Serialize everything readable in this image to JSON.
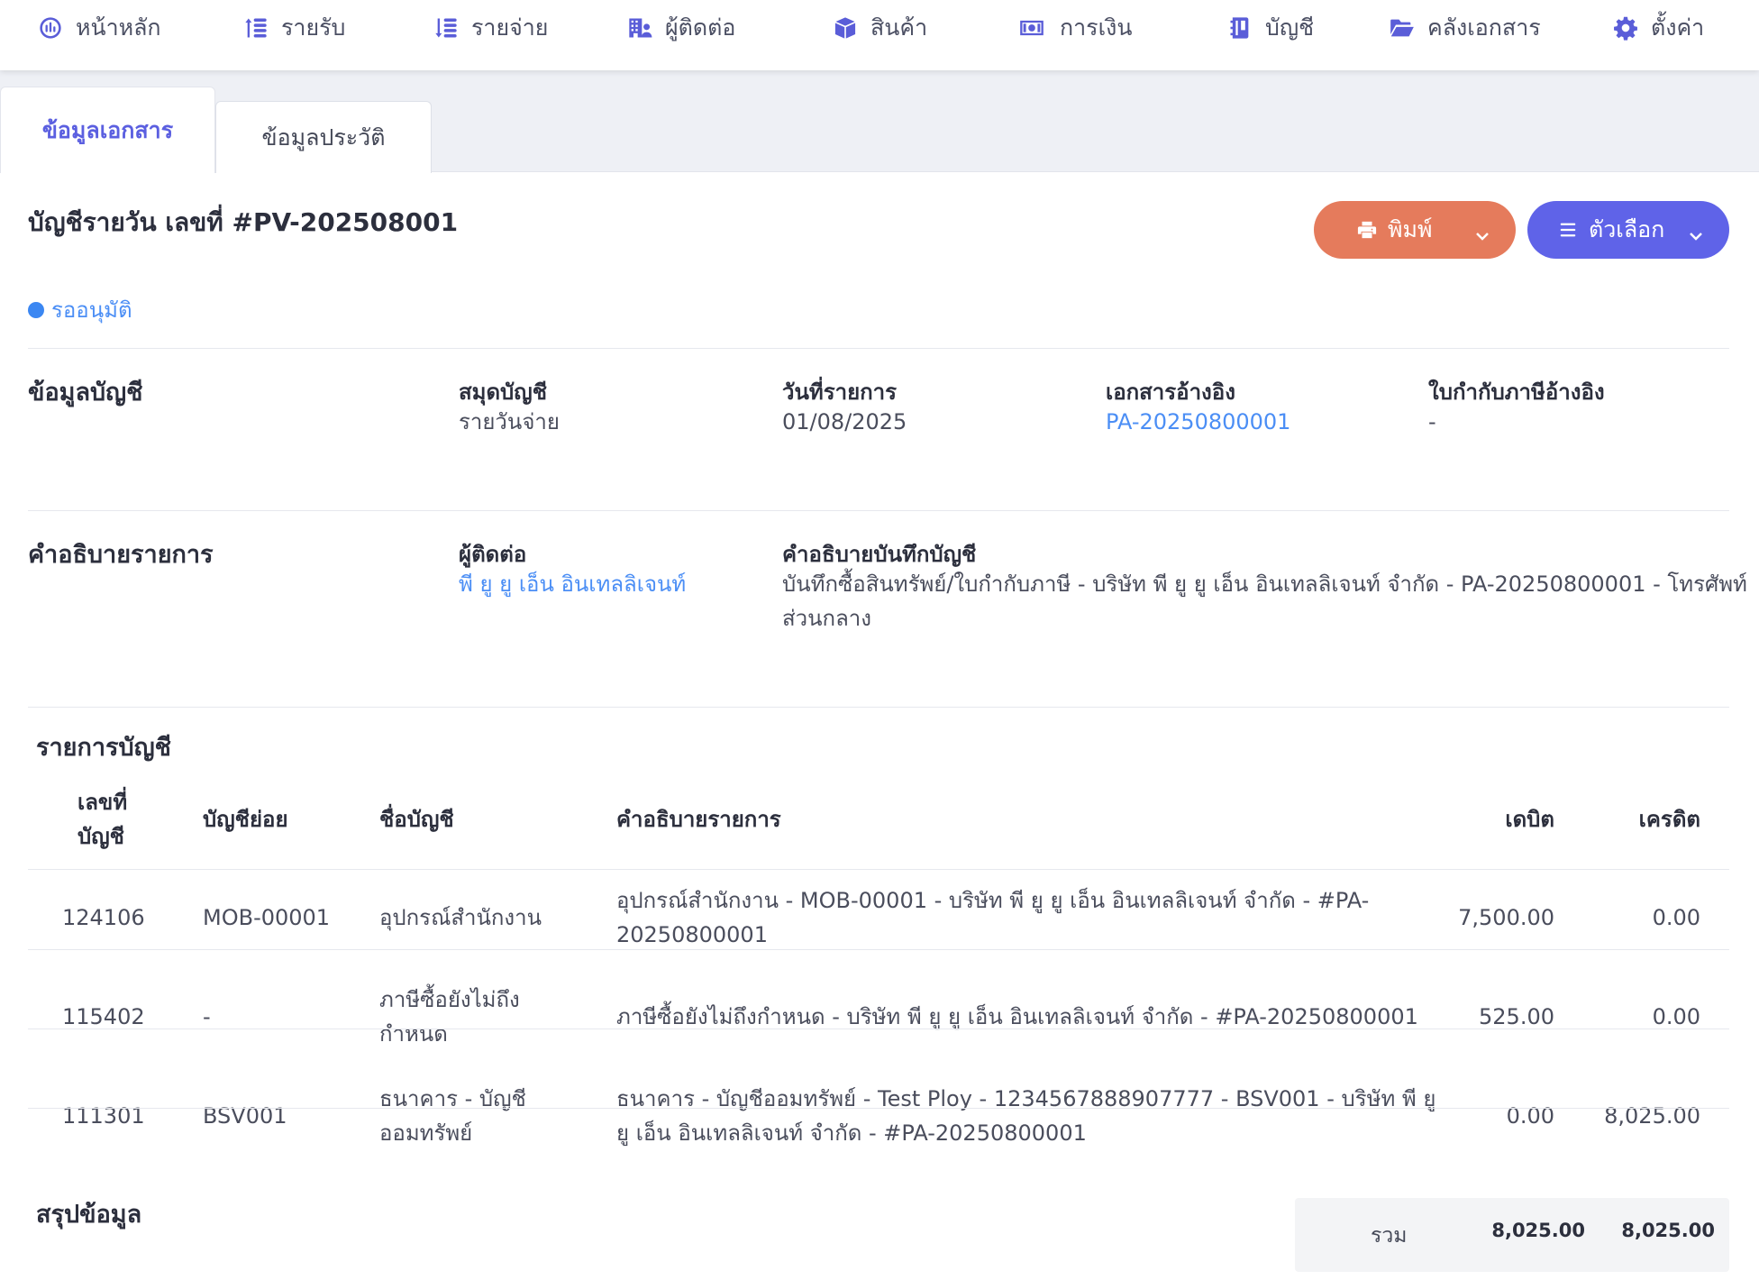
{
  "nav": {
    "items": [
      {
        "label": "หน้าหลัก",
        "icon": "dashboard-icon"
      },
      {
        "label": "รายรับ",
        "icon": "income-icon"
      },
      {
        "label": "รายจ่าย",
        "icon": "expense-icon"
      },
      {
        "label": "ผู้ติดต่อ",
        "icon": "contacts-icon"
      },
      {
        "label": "สินค้า",
        "icon": "box-icon"
      },
      {
        "label": "การเงิน",
        "icon": "money-icon"
      },
      {
        "label": "บัญชี",
        "icon": "book-icon"
      },
      {
        "label": "คลังเอกสาร",
        "icon": "folder-icon"
      },
      {
        "label": "ตั้งค่า",
        "icon": "gear-icon"
      }
    ]
  },
  "tabs": [
    {
      "label": "ข้อมูลเอกสาร",
      "active": true
    },
    {
      "label": "ข้อมูลประวัติ",
      "active": false
    }
  ],
  "document": {
    "title": "บัญชีรายวัน เลขที่ #PV-202508001",
    "status": "รออนุมัติ",
    "print_label": "พิมพ์",
    "options_label": "ตัวเลือก"
  },
  "account_info": {
    "section_title": "ข้อมูลบัญชี",
    "journal_label": "สมุดบัญชี",
    "journal_value": "รายวันจ่าย",
    "date_label": "วันที่รายการ",
    "date_value": "01/08/2025",
    "ref_doc_label": "เอกสารอ้างอิง",
    "ref_doc_value": "PA-20250800001",
    "tax_ref_label": "ใบกำกับภาษีอ้างอิง",
    "tax_ref_value": "-"
  },
  "description_info": {
    "section_title": "คำอธิบายรายการ",
    "contact_label": "ผู้ติดต่อ",
    "contact_value": "พี ยู ยู เอ็น อินเทลลิเจนท์",
    "memo_label": "คำอธิบายบันทึกบัญชี",
    "memo_line1": "บันทึกซื้อสินทรัพย์/ใบกำกับภาษี - บริษัท พี ยู ยู เอ็น อินเทลลิเจนท์ จำกัด - PA-20250800001 - โทรศัพท์",
    "memo_line2": "ส่วนกลาง"
  },
  "entries": {
    "section_title": "รายการบัญชี",
    "columns": {
      "account_no_1": "เลขที่",
      "account_no_2": "บัญชี",
      "sub_account": "บัญชีย่อย",
      "account_name": "ชื่อบัญชี",
      "description": "คำอธิบายรายการ",
      "debit": "เดบิต",
      "credit": "เครดิต"
    },
    "rows": [
      {
        "account_no": "124106",
        "sub_account": "MOB-00001",
        "name_1": "อุปกรณ์สำนักงาน",
        "name_2": "",
        "desc_1": "อุปกรณ์สำนักงาน - MOB-00001 - บริษัท พี ยู ยู เอ็น อินเทลลิเจนท์ จำกัด - #PA-",
        "desc_2": "20250800001",
        "debit": "7,500.00",
        "credit": "0.00"
      },
      {
        "account_no": "115402",
        "sub_account": "-",
        "name_1": "ภาษีซื้อยังไม่ถึง",
        "name_2": "กำหนด",
        "desc_1": "ภาษีซื้อยังไม่ถึงกำหนด - บริษัท พี ยู ยู เอ็น อินเทลลิเจนท์ จำกัด - #PA-20250800001",
        "desc_2": "",
        "debit": "525.00",
        "credit": "0.00"
      },
      {
        "account_no": "111301",
        "sub_account": "BSV001",
        "name_1": "ธนาคาร - บัญชี",
        "name_2": "ออมทรัพย์",
        "desc_1": "ธนาคาร - บัญชีออมทรัพย์ - Test Ploy - 1234567888907777 - BSV001 - บริษัท พี ยู",
        "desc_2": "ยู เอ็น อินเทลลิเจนท์ จำกัด - #PA-20250800001",
        "debit": "0.00",
        "credit": "8,025.00"
      }
    ]
  },
  "summary": {
    "section_title": "สรุปข้อมูล",
    "total_label": "รวม",
    "total_debit": "8,025.00",
    "total_credit": "8,025.00"
  }
}
